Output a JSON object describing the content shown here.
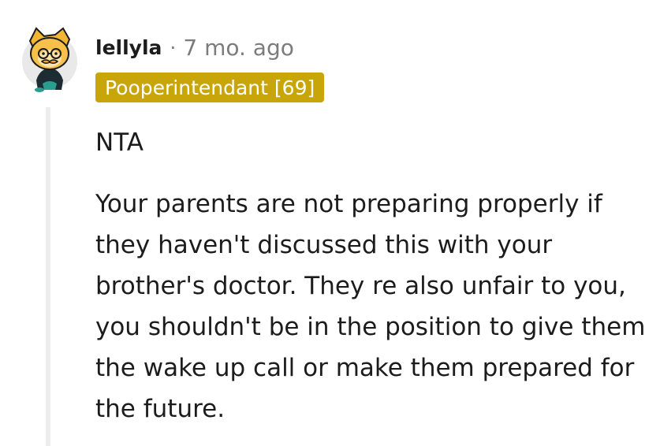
{
  "comment": {
    "username": "lellyla",
    "separator": "·",
    "timestamp": "7 mo. ago",
    "flair": "Pooperintendant [69]",
    "flair_color": "#c8a60a",
    "paragraphs": [
      "NTA",
      "Your parents are not preparing properly if they haven't discussed this with your brother's doctor. They re also unfair to you, you shouldn't be in the position to give them the wake up call or make them prepared for the future."
    ],
    "avatar_icon": "snoo-avatar-icon"
  }
}
